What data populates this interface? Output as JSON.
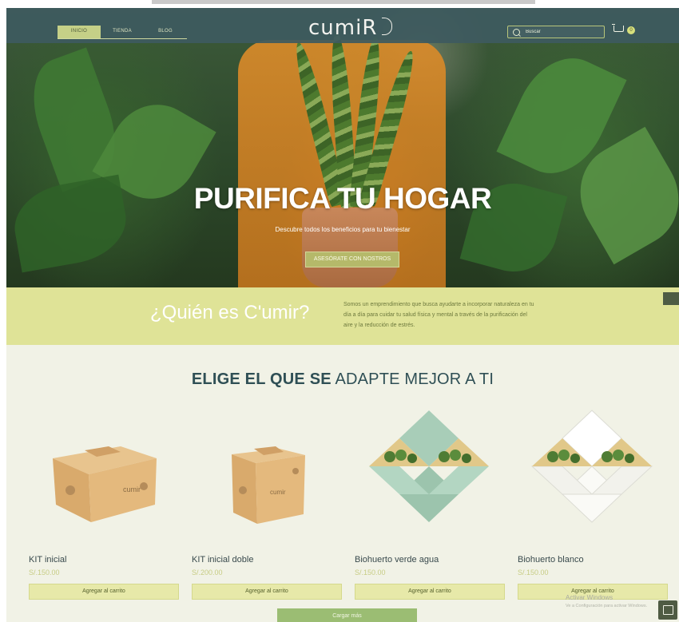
{
  "nav": {
    "items": [
      {
        "label": "INICIO",
        "active": true
      },
      {
        "label": "TIENDA",
        "active": false
      },
      {
        "label": "BLOG",
        "active": false
      }
    ],
    "logo": "cumiR",
    "search_placeholder": "Buscar",
    "cart_count": "0"
  },
  "hero": {
    "title": "PURIFICA TU HOGAR",
    "subtitle": "Descubre todos los beneficios para tu bienestar",
    "cta": "ASESÓRATE CON NOSTROS"
  },
  "who": {
    "title": "¿Quién es C'umir?",
    "text": "Somos un emprendimiento que busca ayudarte a incorporar naturaleza en tu día a día para cuidar tu salud física y mental a través de la purificación del aire y la reducción de estrés."
  },
  "products_section": {
    "title_bold": "ELIGE EL QUE SE",
    "title_rest": " ADAPTE MEJOR A TI",
    "items": [
      {
        "name": "KIT inicial",
        "price": "S/.150.00",
        "button": "Agregar al carrito",
        "box_label": "cumir"
      },
      {
        "name": "KIT inicial doble",
        "price": "S/.200.00",
        "button": "Agregar al carrito",
        "box_label": "cumir"
      },
      {
        "name": "Biohuerto verde agua",
        "price": "S/.150.00",
        "button": "Agregar al carrito"
      },
      {
        "name": "Biohuerto blanco",
        "price": "S/.150.00",
        "button": "Agregar al carrito"
      }
    ],
    "load_more": "Cargar más"
  },
  "os": {
    "watermark_title": "Activar Windows",
    "watermark_sub": "Ve a Configuración para activar Windows."
  },
  "colors": {
    "navbar": "#3e5a5f",
    "accent_green": "#dfe397",
    "button_green": "#9bbd73",
    "page_bg": "#f1f2e6",
    "title_teal": "#2f4f55"
  }
}
